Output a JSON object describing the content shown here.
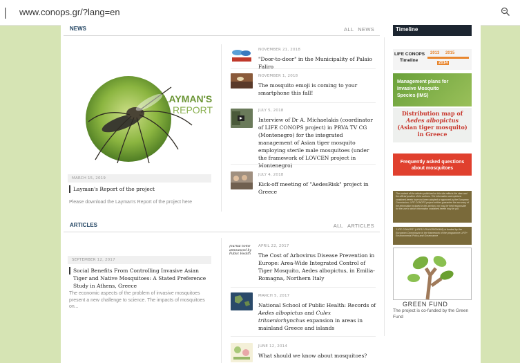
{
  "browser": {
    "separator": "|",
    "url": "www.conops.gr/?lang=en"
  },
  "news": {
    "heading": "NEWS",
    "all": "ALL",
    "cat": "NEWS",
    "featured": {
      "logo_line1": "LAYMAN'S",
      "logo_line2": "REPORT",
      "date": "MARCH 15, 2019",
      "title": "Layman's Report of the project",
      "desc": "Please download the Layman's Report of the project here"
    },
    "items": [
      {
        "date": "NOVEMBER 21, 2018",
        "title": "\"Door-to-door\" in the Municipality of Palaio Faliro"
      },
      {
        "date": "NOVEMBER 1, 2018",
        "title": "The mosquito emoji is coming to your smartphone this fall!"
      },
      {
        "date": "JULY 5, 2018",
        "title": "Interview of Dr A. Michaelakis (coordinator of LIFE CONOPS project) in PRVA TV CG (Montenegro) for the integrated management of Asian tiger mosquito employing sterile male mosquitoes (under the framework of LOVCEN project in Montenegro)"
      },
      {
        "date": "JULY 4, 2018",
        "title": "Kick-off meeting of \"AedesRisk\" project in Greece"
      }
    ]
  },
  "articles": {
    "heading": "ARTICLES",
    "all": "ALL",
    "cat": "ARTICLES",
    "featured": {
      "date": "SEPTEMBER 12, 2017",
      "title": "Social Benefits From Controlling Invasive Asian Tiger and Native Mosquitoes: A Stated Preference Study in Athens, Greece",
      "desc": "The economic aspects of the problem of invasive mosquitoes present a new challenge to science. The impacts of mosquitoes on..."
    },
    "items": [
      {
        "date": "APRIL 22, 2017",
        "title": "The Cost of Arbovirus Disease Prevention in Europe: Area-Wide Integrated Control of Tiger Mosquito, Aedes albopictus, in Emilia-Romagna, Northern Italy"
      },
      {
        "date": "MARCH 5, 2017",
        "title_a": "National School of Public Health: Records of ",
        "title_em1": "Aedes albopictus",
        "title_b": " and ",
        "title_em2": "Culex tritaeniorhynchus",
        "title_c": " expansion in areas in mainland Greece and islands"
      },
      {
        "date": "JUNE 12, 2014",
        "title": "What should we know about mosquitoes?"
      }
    ],
    "thumb_text": "Journal home announced by Public Health"
  },
  "sidebar": {
    "timeline_tab": "Timeline",
    "timeline_banner": {
      "title": "LIFE CONOPS",
      "sub": "Timeline",
      "y1": "2013",
      "y2": "2015",
      "y3": "2014"
    },
    "management": "Management plans for Invasive Mosquito Species (IMS)",
    "distribution_1": "Distribution map of",
    "distribution_2": "Aedes albopictus",
    "distribution_3": "(Asian tiger mosquito)",
    "distribution_4": "in Greece",
    "faq": "Frequently asked questions about mosquitoes",
    "disclaimer1": "The content of the articles published on this site reflects the view and the official position of the authors. The information and opinions contained herein have not been adopted or approved by the European Commission. LIFE CONOPS project neither guarantee the accuracy of the information included in this section, nor may be held responsible for the use to which information contained herein may be put.",
    "disclaimer2": "\"LIFE CONOPS\" (LIFE12 ENV/GR/000466) is funded by the European Commission in the framework of the programme LIFE+ Environmental Policy and Governance",
    "green_fund": "GREEN FUND",
    "green_fund_desc": "The project is co-funded by the Green Fund"
  },
  "colors": {
    "accent": "#1a3d5c",
    "orange": "#e8862e",
    "green": "#6aa13a",
    "red": "#c8372d",
    "olive": "#7a6a3a"
  }
}
